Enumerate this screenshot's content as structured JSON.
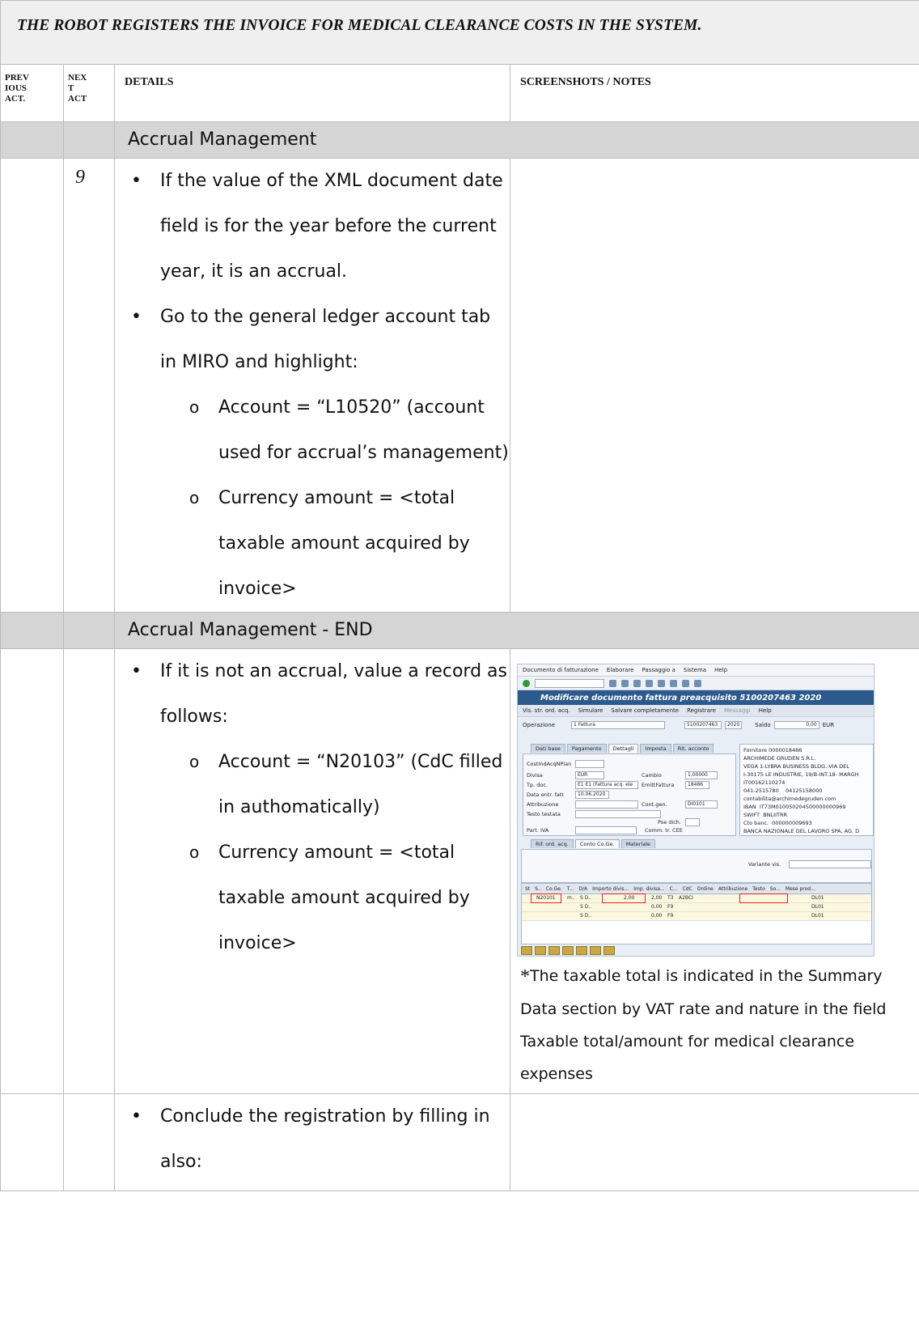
{
  "title": "THE ROBOT REGISTERS THE INVOICE FOR MEDICAL CLEARANCE COSTS IN THE SYSTEM.",
  "headers": {
    "prev": [
      "Prev",
      "ious",
      "Act."
    ],
    "next": [
      "Nex",
      "t",
      "Act"
    ],
    "details": "Details",
    "notes": "Screenshots / Notes"
  },
  "section_1": {
    "title": "Accrual Management",
    "step_number": "9",
    "bullets": [
      "If the value of the XML document date field is for the year before the current year, it is an accrual.",
      "Go to the general ledger  account tab in MIRO and highlight:"
    ],
    "sub_bullets": [
      "Account = “L10520” (account used for accrual’s management)",
      "Currency amount = <total taxable amount acquired by invoice>"
    ]
  },
  "section_2": {
    "title": "Accrual Management - END",
    "bullet": "If it is not an accrual, value a record as follows:",
    "sub_bullets": [
      "Account = “N20103” (CdC filled in authomatically)",
      "Currency amount = <total taxable amount acquired by invoice>"
    ],
    "note_asterisk": "*",
    "note": "The taxable total is indicated in the Summary Data section by VAT rate and nature in the field Taxable total/amount for medical clearance expenses"
  },
  "section_3": {
    "bullet": "Conclude the registration by filling in also:"
  },
  "screenshot": {
    "menu": [
      "Documento di fatturazione",
      "Elaborare",
      "Passaggio a",
      "Sistema",
      "Help"
    ],
    "window_title": "Modificare documento fattura preacquisito 5100207463 2020",
    "app_buttons": [
      "Vis. str. ord. acq.",
      "Simulare",
      "Salvare completamente",
      "Registrare",
      "Messaggi",
      "Help"
    ],
    "operazione_label": "Operazione",
    "operazione_value": "1 Fattura",
    "doc_no": "5100207463",
    "year": "2020",
    "saldo_label": "Saldo",
    "saldo_value": "0,00",
    "currency_short": "EUR",
    "tabs": [
      "Dati base",
      "Pagamento",
      "Dettagli",
      "Imposta",
      "Rit. acconto"
    ],
    "fields": {
      "costind_label": "CostIndAcqNPian",
      "divisa_label": "Divisa",
      "divisa_value": "EUR",
      "cambio_label": "Cambio",
      "cambio_value": "1,00000",
      "tpdoc_label": "Tp. doc.",
      "tpdoc_value": "E1 E1 (Fattura acq. ele",
      "emitt_label": "EmittFattura",
      "emitt_value": "18486",
      "data_label": "Data entr. fatt",
      "data_value": "10.06.2020",
      "attrib_label": "Attribuzione",
      "contgen_label": "Cont.gen.",
      "contgen_value": "DI0101",
      "testo_label": "Testo testata",
      "pse_label": "Pse dich.",
      "partiva_label": "Part. IVA",
      "comm_label": "Comm. tr. CEE"
    },
    "vendor": {
      "title": "Fornitore 0000018486",
      "lines": [
        "ARCHIMEDE GRUDEN S.R.L.",
        "VEGA 1-LYBRA BUSINESS BLDG.-VIA DEL",
        "I-30175 LE INDUSTRIE, 19/B-INT.18- MARGH",
        "IT00162110274",
        "041-2515780",
        "contabilita@archimedegruden.com"
      ],
      "fax": "04125158000",
      "iban_label": "IBAN",
      "iban_value": "IT73M010050204500000000969",
      "swift_label": "SWIFT",
      "swift_value": "BNLIITRR",
      "cto_label": "Cto banc.",
      "cto_value": "000000009693",
      "bank": "BANCA NAZIONALE DEL LAVORO SPA, AG. D"
    },
    "lower_tabs": [
      "Rif. ord. acq.",
      "Conto Co.Ge.",
      "Materiale"
    ],
    "variante_label": "Variante vis.",
    "grid_headers": [
      "St",
      "S..",
      "Co.Ge.",
      "T...",
      "D/A",
      "Importo divis...",
      "Imp. divisa...",
      "C...",
      "CdC",
      "Ordine",
      "Attribuzione",
      "Testo",
      "So...",
      "Mese prod..."
    ],
    "grid_rows": [
      {
        "coge": "N20101",
        "t": "m..",
        "da": "S D..",
        "importo": "2,00",
        "imp": "2,00",
        "c": "T3",
        "cdc": "A2BCI",
        "so": "DL01"
      },
      {
        "coge": "",
        "t": "",
        "da": "S D..",
        "importo": "",
        "imp": "0,00",
        "c": "F9",
        "cdc": "",
        "so": "DL01"
      },
      {
        "coge": "",
        "t": "",
        "da": "S D..",
        "importo": "",
        "imp": "0,00",
        "c": "F9",
        "cdc": "",
        "so": "DL01"
      }
    ]
  }
}
